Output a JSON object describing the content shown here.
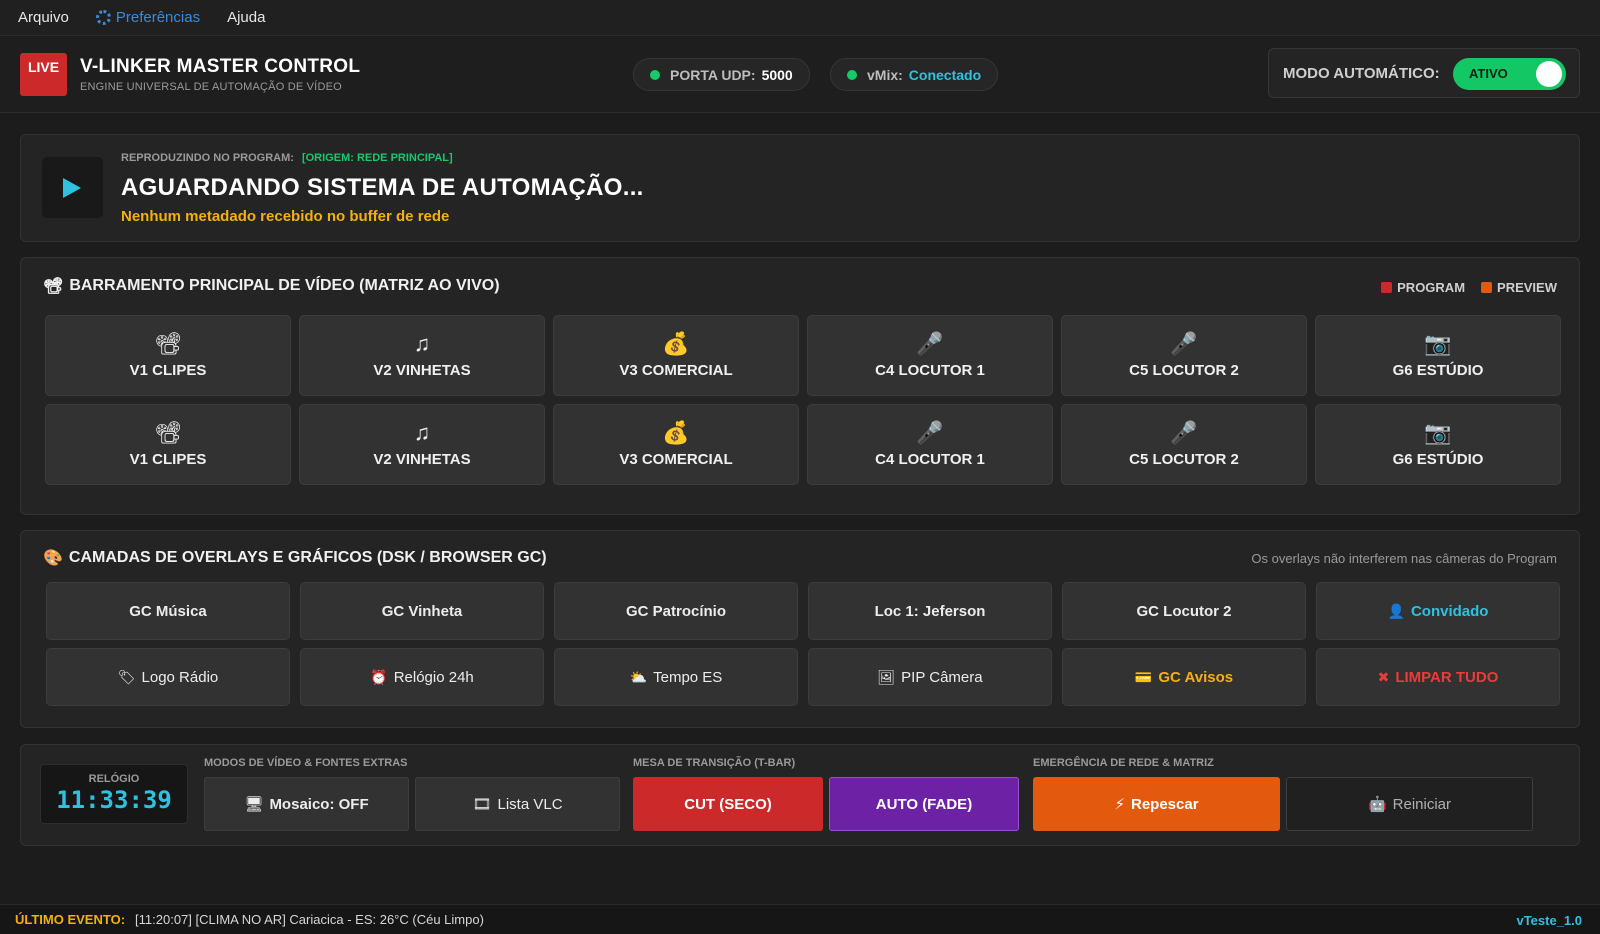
{
  "menu": {
    "file": "Arquivo",
    "prefs": "Preferências",
    "help": "Ajuda"
  },
  "header": {
    "badge": "LIVE",
    "title": "V-LINKER MASTER CONTROL",
    "subtitle": "ENGINE UNIVERSAL DE AUTOMAÇÃO DE VÍDEO",
    "udp_label": "PORTA UDP:",
    "udp_value": "5000",
    "vmix_label": "vMix:",
    "vmix_value": "Conectado",
    "auto_label": "MODO AUTOMÁTICO:",
    "auto_state": "ATIVO",
    "status_color": "#16c96a"
  },
  "now_playing": {
    "label": "REPRODUZINDO NO PROGRAM:",
    "origin": "[ORIGEM: REDE PRINCIPAL]",
    "title": "AGUARDANDO SISTEMA DE AUTOMAÇÃO...",
    "subtitle": "Nenhum metadado recebido no buffer de rede"
  },
  "bus": {
    "title": "BARRAMENTO PRINCIPAL DE VÍDEO (MATRIZ AO VIVO)",
    "legend_program": "PROGRAM",
    "legend_preview": "PREVIEW",
    "program_color": "#cc2a2a",
    "preview_color": "#e35a0e",
    "program_row": [
      {
        "icon": "camera-icon",
        "label": "V1 CLIPES"
      },
      {
        "icon": "music-note-icon",
        "label": "V2 VINHETAS"
      },
      {
        "icon": "money-bag-icon",
        "label": "V3 COMERCIAL"
      },
      {
        "icon": "microphone-icon",
        "label": "C4 LOCUTOR 1"
      },
      {
        "icon": "microphone-icon",
        "label": "C5 LOCUTOR 2"
      },
      {
        "icon": "studio-camera-icon",
        "label": "G6 ESTÚDIO"
      }
    ],
    "preview_row": [
      {
        "icon": "camera-icon",
        "label": "V1 CLIPES"
      },
      {
        "icon": "music-note-icon",
        "label": "V2 VINHETAS"
      },
      {
        "icon": "money-bag-icon",
        "label": "V3 COMERCIAL"
      },
      {
        "icon": "microphone-icon",
        "label": "C4 LOCUTOR 1"
      },
      {
        "icon": "microphone-icon",
        "label": "C5 LOCUTOR 2"
      },
      {
        "icon": "studio-camera-icon",
        "label": "G6 ESTÚDIO"
      }
    ]
  },
  "overlays": {
    "title": "CAMADAS DE OVERLAYS E GRÁFICOS (DSK / BROWSER GC)",
    "note": "Os overlays não interferem nas câmeras do Program",
    "row1": [
      "GC Música",
      "GC Vinheta",
      "GC Patrocínio",
      "Loc 1: Jeferson",
      "GC Locutor 2",
      "Convidado"
    ],
    "row2": [
      "Logo Rádio",
      "Relógio 24h",
      "Tempo ES",
      "PIP Câmera",
      "GC Avisos",
      "LIMPAR TUDO"
    ]
  },
  "controls": {
    "clock_label": "RELÓGIO",
    "clock_time": "11:33:39",
    "group_modes": "MODOS DE VÍDEO & FONTES EXTRAS",
    "mosaic": "Mosaico: OFF",
    "vlc": "Lista VLC",
    "group_transition": "MESA DE TRANSIÇÃO (T-BAR)",
    "cut": "CUT (SECO)",
    "auto": "AUTO (FADE)",
    "group_emergency": "EMERGÊNCIA DE REDE & MATRIZ",
    "rescan": "Repescar",
    "restart": "Reiniciar"
  },
  "status": {
    "label": "ÚLTIMO EVENTO:",
    "value": "[11:20:07] [CLIMA NO AR] Cariacica - ES: 26°C (Céu Limpo)",
    "version": "vTeste_1.0"
  }
}
